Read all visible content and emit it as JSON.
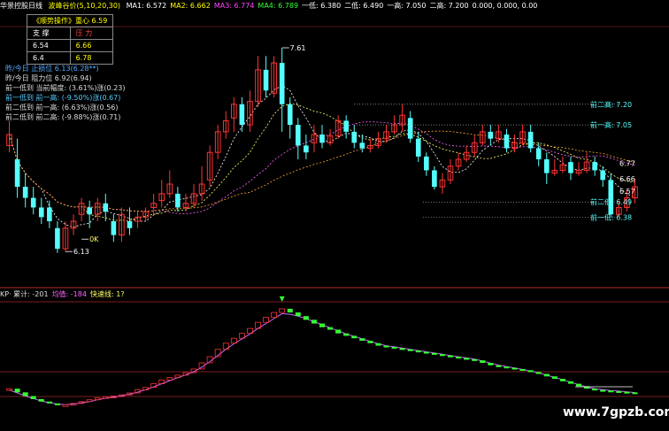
{
  "header": {
    "title": "华景控股日线",
    "indicator": "波峰谷价(5,10,20,30)",
    "ma_items": [
      {
        "label": "MA1: 6.572",
        "color": "#ffffff"
      },
      {
        "label": "MA2: 6.662",
        "color": "#ffff00"
      },
      {
        "label": "MA3: 6.774",
        "color": "#ff44ff"
      },
      {
        "label": "MA4: 6.789",
        "color": "#33ff33"
      },
      {
        "label": "一低: 6.380",
        "color": "#ffffff"
      },
      {
        "label": "二低: 6.490",
        "color": "#ffffff"
      },
      {
        "label": "一高: 7.050",
        "color": "#ffffff"
      },
      {
        "label": "二高: 7.200",
        "color": "#ffffff"
      },
      {
        "label": "0.000, 0.000, 0.00",
        "color": "#ffffff"
      }
    ]
  },
  "panel": {
    "title": "《顺势操作》重心 6.59",
    "headers": [
      "支 撑",
      "压 力"
    ],
    "rows": [
      [
        "6.54",
        "6.66"
      ],
      [
        "6.4",
        "6.78"
      ]
    ]
  },
  "info_lines": [
    {
      "text": "昨/今日 止损位  6.13(6.28**)",
      "color": "#55aaff"
    },
    {
      "text": "昨/今日 阻力位  6.92(6.94)",
      "color": "#dddddd"
    },
    {
      "text": "前一低到 当前幅度: (3.61%)涨(0.23)",
      "color": "#dddddd"
    },
    {
      "text": "前一低到 前一高: (-9.50%)涨(0.67)",
      "color": "#55ccff"
    },
    {
      "text": "前二低到 前一高: (6.63%)涨(0.56)",
      "color": "#dddddd"
    },
    {
      "text": "前二低到 前二高: (-9.88%)涨(0.71)",
      "color": "#dddddd"
    }
  ],
  "indicator_header": {
    "items": [
      {
        "label": "KP· 累计: -201",
        "color": "#dddddd"
      },
      {
        "label": "均值: -184",
        "color": "#ff66ff"
      },
      {
        "label": "快速线: 1?",
        "color": "#ffff66"
      }
    ]
  },
  "watermark": "www.7gpzb.com",
  "chart_data": {
    "type": "candlestick",
    "price_axis": {
      "ylim": [
        5.9,
        7.7
      ]
    },
    "candles": [
      [
        6.9,
        6.98,
        7.08,
        6.85
      ],
      [
        6.8,
        6.6,
        6.95,
        6.52
      ],
      [
        6.6,
        6.52,
        6.7,
        6.45
      ],
      [
        6.52,
        6.45,
        6.6,
        6.4
      ],
      [
        6.45,
        6.38,
        6.52,
        6.33
      ],
      [
        6.45,
        6.35,
        6.5,
        6.3
      ],
      [
        6.3,
        6.15,
        6.35,
        6.12
      ],
      [
        6.15,
        6.3,
        6.35,
        6.13
      ],
      [
        6.3,
        6.35,
        6.4,
        6.25
      ],
      [
        6.4,
        6.48,
        6.52,
        6.35
      ],
      [
        6.45,
        6.4,
        6.5,
        6.3
      ],
      [
        6.4,
        6.48,
        6.52,
        6.35
      ],
      [
        6.48,
        6.42,
        6.55,
        6.35
      ],
      [
        6.35,
        6.25,
        6.4,
        6.2
      ],
      [
        6.25,
        6.4,
        6.45,
        6.2
      ],
      [
        6.35,
        6.3,
        6.45,
        6.25
      ],
      [
        6.35,
        6.38,
        6.42,
        6.3
      ],
      [
        6.38,
        6.42,
        6.45,
        6.35
      ],
      [
        6.45,
        6.48,
        6.55,
        6.4
      ],
      [
        6.5,
        6.55,
        6.65,
        6.45
      ],
      [
        6.55,
        6.62,
        6.72,
        6.52
      ],
      [
        6.55,
        6.45,
        6.6,
        6.42
      ],
      [
        6.45,
        6.48,
        6.55,
        6.42
      ],
      [
        6.48,
        6.55,
        6.62,
        6.45
      ],
      [
        6.55,
        6.62,
        6.75,
        6.5
      ],
      [
        6.65,
        6.85,
        6.9,
        6.6
      ],
      [
        6.85,
        7.0,
        7.05,
        6.8
      ],
      [
        7.0,
        7.08,
        7.15,
        6.95
      ],
      [
        7.1,
        7.2,
        7.25,
        7.0
      ],
      [
        7.2,
        7.05,
        7.25,
        7.0
      ],
      [
        7.05,
        7.22,
        7.3,
        7.0
      ],
      [
        7.22,
        7.45,
        7.55,
        7.18
      ],
      [
        7.45,
        7.3,
        7.55,
        7.25
      ],
      [
        7.28,
        7.5,
        7.55,
        7.25
      ],
      [
        7.5,
        7.2,
        7.61,
        7.0
      ],
      [
        7.2,
        7.05,
        7.25,
        6.95
      ],
      [
        7.05,
        6.9,
        7.1,
        6.8
      ],
      [
        6.9,
        6.85,
        6.98,
        6.8
      ],
      [
        6.92,
        6.98,
        7.05,
        6.85
      ],
      [
        6.98,
        6.92,
        7.05,
        6.88
      ],
      [
        6.92,
        6.97,
        7.02,
        6.9
      ],
      [
        6.97,
        7.08,
        7.12,
        6.95
      ],
      [
        7.08,
        7.0,
        7.12,
        6.95
      ],
      [
        7.0,
        6.92,
        7.05,
        6.88
      ],
      [
        6.92,
        6.88,
        6.98,
        6.85
      ],
      [
        6.88,
        6.9,
        6.95,
        6.85
      ],
      [
        6.9,
        6.95,
        7.0,
        6.88
      ],
      [
        6.95,
        7.0,
        7.05,
        6.92
      ],
      [
        7.0,
        7.05,
        7.12,
        6.98
      ],
      [
        7.05,
        7.12,
        7.2,
        7.0
      ],
      [
        7.1,
        6.95,
        7.15,
        6.92
      ],
      [
        6.95,
        6.82,
        7.0,
        6.78
      ],
      [
        6.82,
        6.72,
        6.85,
        6.68
      ],
      [
        6.72,
        6.6,
        6.75,
        6.58
      ],
      [
        6.6,
        6.65,
        6.7,
        6.55
      ],
      [
        6.65,
        6.75,
        6.8,
        6.62
      ],
      [
        6.75,
        6.8,
        6.85,
        6.72
      ],
      [
        6.8,
        6.85,
        6.9,
        6.78
      ],
      [
        6.85,
        6.92,
        6.98,
        6.82
      ],
      [
        6.92,
        7.0,
        7.05,
        6.9
      ],
      [
        7.0,
        6.95,
        7.05,
        6.9
      ],
      [
        6.95,
        7.0,
        7.05,
        6.92
      ],
      [
        6.98,
        6.88,
        7.02,
        6.85
      ],
      [
        6.88,
        6.92,
        6.98,
        6.85
      ],
      [
        6.92,
        7.0,
        7.05,
        6.9
      ],
      [
        7.0,
        6.88,
        7.05,
        6.85
      ],
      [
        6.88,
        6.8,
        6.92,
        6.75
      ],
      [
        6.8,
        6.7,
        6.85,
        6.62
      ],
      [
        6.7,
        6.72,
        6.8,
        6.68
      ],
      [
        6.72,
        6.76,
        6.82,
        6.7
      ],
      [
        6.78,
        6.7,
        6.82,
        6.65
      ],
      [
        6.7,
        6.72,
        6.78,
        6.68
      ],
      [
        6.72,
        6.78,
        6.85,
        6.7
      ],
      [
        6.78,
        6.72,
        6.82,
        6.68
      ],
      [
        6.72,
        6.65,
        6.75,
        6.6
      ],
      [
        6.65,
        6.4,
        6.7,
        6.38
      ],
      [
        6.4,
        6.45,
        6.5,
        6.38
      ],
      [
        6.45,
        6.52,
        6.58,
        6.42
      ],
      [
        6.52,
        6.6,
        6.66,
        6.48
      ]
    ],
    "annotations": [
      {
        "text": "7.61",
        "idx": 34,
        "price": 7.61
      },
      {
        "text": "6.13",
        "idx": 7,
        "price": 6.13
      },
      {
        "text": "前二高: 7.20",
        "price": 7.2
      },
      {
        "text": "前一高: 7.05",
        "price": 7.05
      },
      {
        "text": "前二低: 6.49",
        "price": 6.49
      },
      {
        "text": "前一低: 6.38",
        "price": 6.38
      },
      {
        "text": "6.77",
        "price": 6.77
      },
      {
        "text": "6.66",
        "price": 6.66
      },
      {
        "text": "6.57",
        "price": 6.57
      },
      {
        "text": "0K",
        "idx": 9,
        "price": 6.22
      }
    ],
    "indicator": {
      "ylim": [
        -300,
        600
      ],
      "values": [
        -150,
        -180,
        -210,
        -235,
        -255,
        -270,
        -285,
        -280,
        -270,
        -255,
        -240,
        -225,
        -215,
        -210,
        -200,
        -185,
        -160,
        -140,
        -110,
        -80,
        -60,
        -40,
        -20,
        10,
        60,
        110,
        170,
        220,
        260,
        300,
        340,
        390,
        430,
        470,
        500,
        470,
        440,
        410,
        380,
        350,
        330,
        300,
        280,
        260,
        240,
        220,
        200,
        190,
        180,
        170,
        160,
        150,
        140,
        130,
        120,
        110,
        100,
        90,
        80,
        60,
        40,
        30,
        20,
        10,
        0,
        -15,
        -30,
        -50,
        -70,
        -90,
        -110,
        -130,
        -150,
        -160,
        -165,
        -170,
        -175,
        -180,
        -185
      ],
      "avg": [
        -160,
        -185,
        -210,
        -230,
        -250,
        -265,
        -275,
        -280,
        -275,
        -265,
        -255,
        -240,
        -228,
        -218,
        -208,
        -195,
        -178,
        -158,
        -135,
        -110,
        -85,
        -60,
        -38,
        -12,
        25,
        70,
        120,
        170,
        215,
        255,
        295,
        340,
        380,
        420,
        460,
        455,
        440,
        420,
        395,
        370,
        345,
        320,
        295,
        275,
        255,
        235,
        215,
        200,
        190,
        180,
        170,
        160,
        150,
        140,
        130,
        120,
        110,
        100,
        90,
        75,
        58,
        42,
        30,
        18,
        6,
        -8,
        -22,
        -40,
        -58,
        -78,
        -98,
        -118,
        -138,
        -150,
        -158,
        -165,
        -170,
        -176,
        -182
      ]
    }
  }
}
